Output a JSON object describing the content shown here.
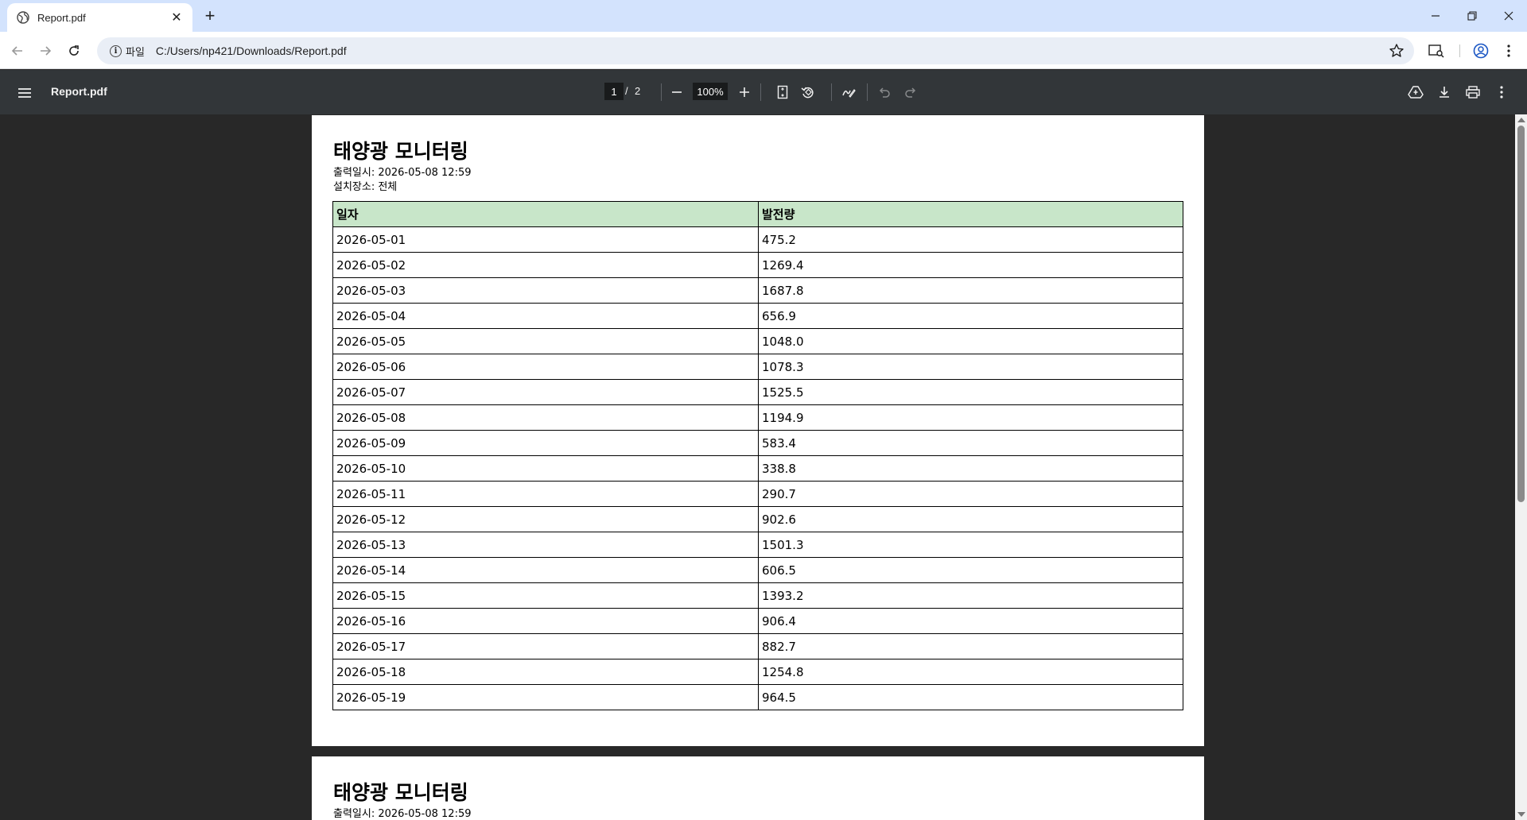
{
  "browser": {
    "tab_title": "Report.pdf",
    "tab_close_glyph": "✕",
    "new_tab_glyph": "+",
    "site_chip_label": "파일",
    "url": "C:/Users/np421/Downloads/Report.pdf"
  },
  "pdf_toolbar": {
    "title": "Report.pdf",
    "current_page": "1",
    "page_separator": "/",
    "total_pages": "2",
    "zoom": "100%"
  },
  "report": {
    "title": "태양광 모니터링",
    "printed_at": "출력일시: 2026-05-08 12:59",
    "location": "설치장소: 전체",
    "columns": [
      "일자",
      "발전량"
    ],
    "rows": [
      [
        "2026-05-01",
        "475.2"
      ],
      [
        "2026-05-02",
        "1269.4"
      ],
      [
        "2026-05-03",
        "1687.8"
      ],
      [
        "2026-05-04",
        "656.9"
      ],
      [
        "2026-05-05",
        "1048.0"
      ],
      [
        "2026-05-06",
        "1078.3"
      ],
      [
        "2026-05-07",
        "1525.5"
      ],
      [
        "2026-05-08",
        "1194.9"
      ],
      [
        "2026-05-09",
        "583.4"
      ],
      [
        "2026-05-10",
        "338.8"
      ],
      [
        "2026-05-11",
        "290.7"
      ],
      [
        "2026-05-12",
        "902.6"
      ],
      [
        "2026-05-13",
        "1501.3"
      ],
      [
        "2026-05-14",
        "606.5"
      ],
      [
        "2026-05-15",
        "1393.2"
      ],
      [
        "2026-05-16",
        "906.4"
      ],
      [
        "2026-05-17",
        "882.7"
      ],
      [
        "2026-05-18",
        "1254.8"
      ],
      [
        "2026-05-19",
        "964.5"
      ]
    ]
  },
  "page2": {
    "title": "태양광 모니터링",
    "printed_at": "출력일시: 2026-05-08 12:59"
  },
  "colors": {
    "tabstrip_bg": "#d3e3fd",
    "pdf_toolbar_bg": "#323639",
    "viewer_bg": "#282828",
    "table_header_bg": "#c8e6c9"
  }
}
